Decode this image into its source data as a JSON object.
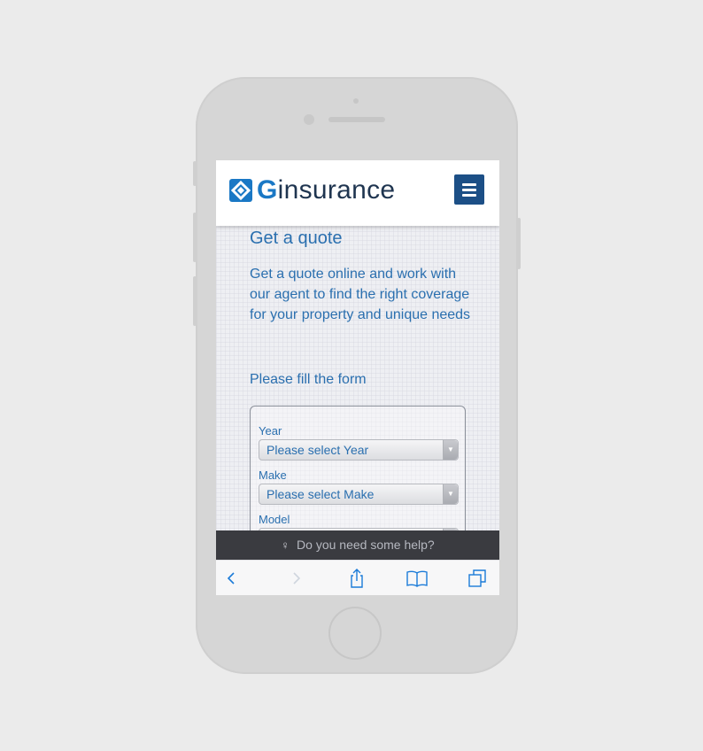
{
  "header": {
    "logo_initial": "G",
    "logo_rest": "insurance"
  },
  "main": {
    "title": "Get a quote",
    "intro": "Get a quote online and work with our agent to find the right coverage for your property and unique needs",
    "form_heading": "Please fill the form"
  },
  "form": {
    "fields": [
      {
        "label": "Year",
        "value": "Please select Year"
      },
      {
        "label": "Make",
        "value": "Please select Make"
      },
      {
        "label": "Model",
        "value": ""
      }
    ]
  },
  "help_bar": {
    "text": "Do you need some help?"
  },
  "toolbar": {
    "icons": [
      "back-icon",
      "forward-icon",
      "share-icon",
      "bookmarks-icon",
      "tabs-icon"
    ]
  },
  "colors": {
    "brand_blue": "#1a78c5",
    "brand_navy": "#1c4f86",
    "text_blue": "#2a6faf",
    "ios_blue": "#1b7bd8"
  }
}
